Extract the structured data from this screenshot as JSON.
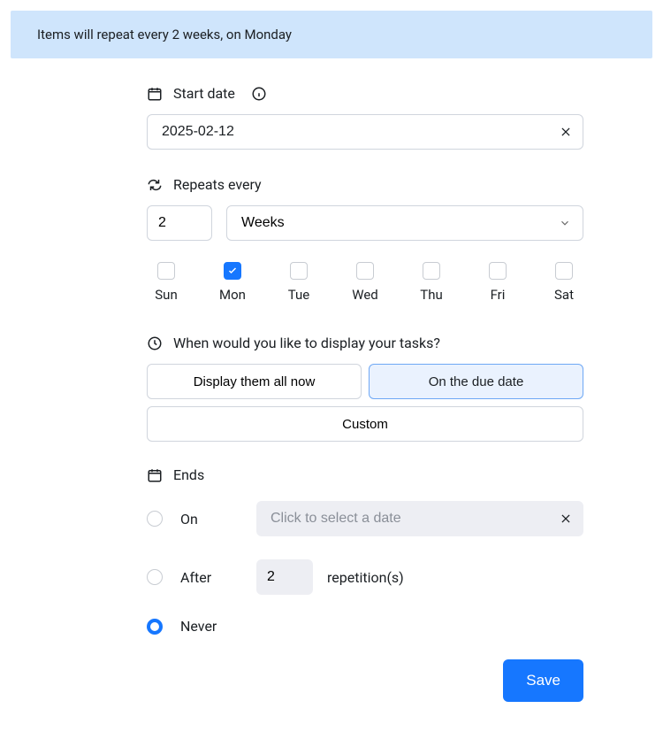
{
  "banner": {
    "text": "Items will repeat every 2 weeks, on Monday"
  },
  "start_date": {
    "label": "Start date",
    "value": "2025-02-12"
  },
  "repeats": {
    "label": "Repeats every",
    "interval": "2",
    "unit": "Weeks",
    "days": [
      {
        "short": "Sun",
        "checked": false
      },
      {
        "short": "Mon",
        "checked": true
      },
      {
        "short": "Tue",
        "checked": false
      },
      {
        "short": "Wed",
        "checked": false
      },
      {
        "short": "Thu",
        "checked": false
      },
      {
        "short": "Fri",
        "checked": false
      },
      {
        "short": "Sat",
        "checked": false
      }
    ]
  },
  "display": {
    "label": "When would you like to display your tasks?",
    "option_all_now": "Display them all now",
    "option_due_date": "On the due date",
    "option_custom": "Custom",
    "selected": "due_date"
  },
  "ends": {
    "label": "Ends",
    "on_label": "On",
    "on_placeholder": "Click to select a date",
    "after_label": "After",
    "after_count": "2",
    "after_suffix": "repetition(s)",
    "never_label": "Never",
    "selected": "never"
  },
  "footer": {
    "save": "Save"
  }
}
